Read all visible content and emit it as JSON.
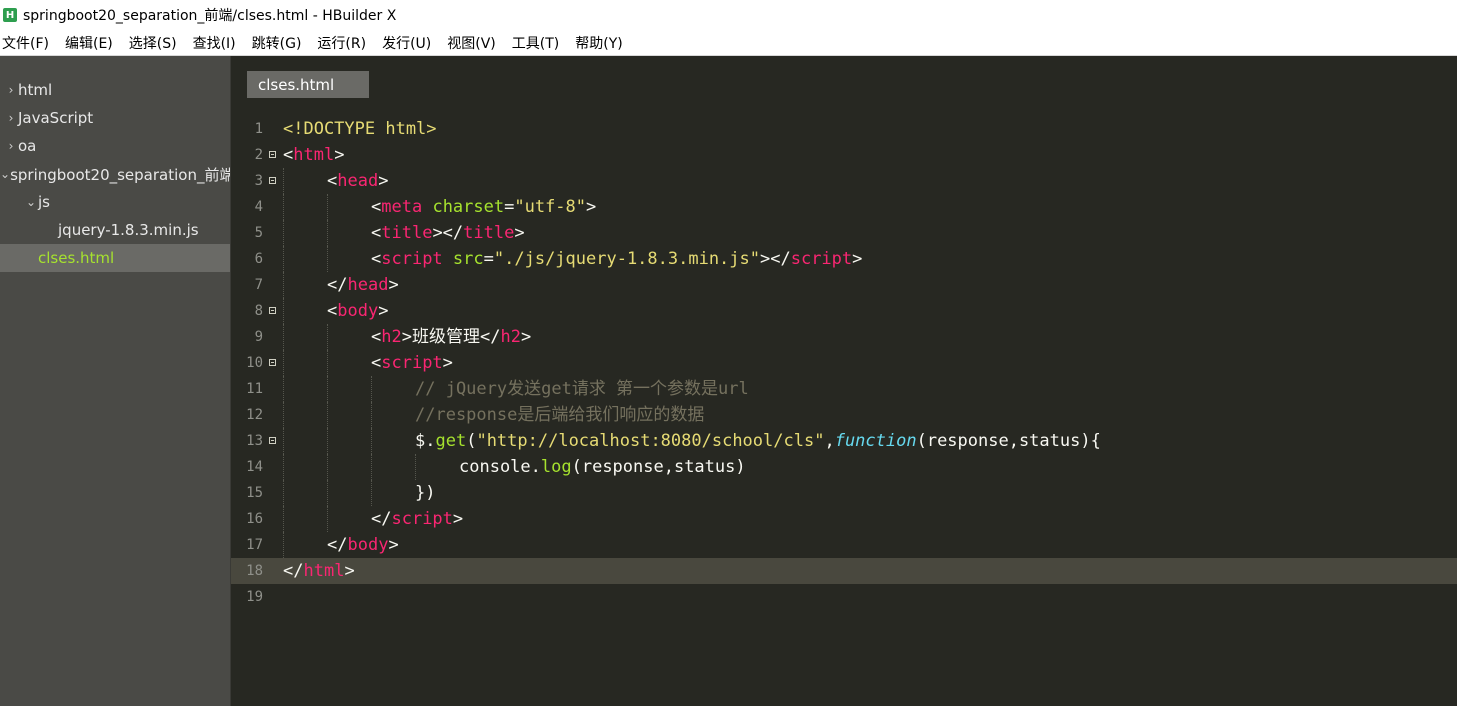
{
  "window": {
    "title": "springboot20_separation_前端/clses.html - HBuilder X",
    "icon_text": "H"
  },
  "menu": [
    "文件(F)",
    "编辑(E)",
    "选择(S)",
    "查找(I)",
    "跳转(G)",
    "运行(R)",
    "发行(U)",
    "视图(V)",
    "工具(T)",
    "帮助(Y)"
  ],
  "sidebar": {
    "items": [
      {
        "label": "html",
        "indent": 0,
        "chevron": "›"
      },
      {
        "label": "JavaScript",
        "indent": 0,
        "chevron": "›"
      },
      {
        "label": "oa",
        "indent": 0,
        "chevron": "›"
      },
      {
        "label": "springboot20_separation_前端",
        "indent": 0,
        "chevron": "⌄"
      },
      {
        "label": "js",
        "indent": 1,
        "chevron": "⌄"
      },
      {
        "label": "jquery-1.8.3.min.js",
        "indent": 2,
        "chevron": ""
      },
      {
        "label": "clses.html",
        "indent": 1,
        "chevron": "",
        "selected": true,
        "color": "#a6e22e"
      }
    ]
  },
  "editor": {
    "tab_label": "clses.html",
    "current_line": 18,
    "lines": [
      {
        "n": "1",
        "fold": false,
        "depth": 0,
        "tokens": [
          [
            "t-str",
            "<!DOCTYPE html>"
          ]
        ]
      },
      {
        "n": "2",
        "fold": true,
        "depth": 0,
        "tokens": [
          [
            "t-pl",
            "<"
          ],
          [
            "t-tag",
            "html"
          ],
          [
            "t-pl",
            ">"
          ]
        ]
      },
      {
        "n": "3",
        "fold": true,
        "depth": 1,
        "tokens": [
          [
            "t-pl",
            "<"
          ],
          [
            "t-tag",
            "head"
          ],
          [
            "t-pl",
            ">"
          ]
        ]
      },
      {
        "n": "4",
        "fold": false,
        "depth": 2,
        "tokens": [
          [
            "t-pl",
            "<"
          ],
          [
            "t-tag",
            "meta"
          ],
          [
            "t-pl",
            " "
          ],
          [
            "t-attr",
            "charset"
          ],
          [
            "t-pl",
            "="
          ],
          [
            "t-str",
            "\"utf-8\""
          ],
          [
            "t-pl",
            ">"
          ]
        ]
      },
      {
        "n": "5",
        "fold": false,
        "depth": 2,
        "tokens": [
          [
            "t-pl",
            "<"
          ],
          [
            "t-tag",
            "title"
          ],
          [
            "t-pl",
            "></"
          ],
          [
            "t-tag",
            "title"
          ],
          [
            "t-pl",
            ">"
          ]
        ]
      },
      {
        "n": "6",
        "fold": false,
        "depth": 2,
        "tokens": [
          [
            "t-pl",
            "<"
          ],
          [
            "t-tag",
            "script"
          ],
          [
            "t-pl",
            " "
          ],
          [
            "t-attr",
            "src"
          ],
          [
            "t-pl",
            "="
          ],
          [
            "t-str",
            "\"./js/jquery-1.8.3.min.js\""
          ],
          [
            "t-pl",
            "></"
          ],
          [
            "t-tag",
            "script"
          ],
          [
            "t-pl",
            ">"
          ]
        ]
      },
      {
        "n": "7",
        "fold": false,
        "depth": 1,
        "tokens": [
          [
            "t-pl",
            "</"
          ],
          [
            "t-tag",
            "head"
          ],
          [
            "t-pl",
            ">"
          ]
        ]
      },
      {
        "n": "8",
        "fold": true,
        "depth": 1,
        "tokens": [
          [
            "t-pl",
            "<"
          ],
          [
            "t-tag",
            "body"
          ],
          [
            "t-pl",
            ">"
          ]
        ]
      },
      {
        "n": "9",
        "fold": false,
        "depth": 2,
        "tokens": [
          [
            "t-pl",
            "<"
          ],
          [
            "t-tag",
            "h2"
          ],
          [
            "t-pl",
            ">班级管理</"
          ],
          [
            "t-tag",
            "h2"
          ],
          [
            "t-pl",
            ">"
          ]
        ]
      },
      {
        "n": "10",
        "fold": true,
        "depth": 2,
        "tokens": [
          [
            "t-pl",
            "<"
          ],
          [
            "t-tag",
            "script"
          ],
          [
            "t-pl",
            ">"
          ]
        ]
      },
      {
        "n": "11",
        "fold": false,
        "depth": 3,
        "tokens": [
          [
            "t-cm",
            "// jQuery发送get请求 第一个参数是url"
          ]
        ]
      },
      {
        "n": "12",
        "fold": false,
        "depth": 3,
        "tokens": [
          [
            "t-cm",
            "//response是后端给我们响应的数据"
          ]
        ]
      },
      {
        "n": "13",
        "fold": true,
        "depth": 3,
        "tokens": [
          [
            "t-pl",
            "$."
          ],
          [
            "t-fn",
            "get"
          ],
          [
            "t-pl",
            "("
          ],
          [
            "t-str",
            "\"http://localhost:8080/school/cls\""
          ],
          [
            "t-pl",
            ","
          ],
          [
            "t-kw",
            "function"
          ],
          [
            "t-pl",
            "(response,status){"
          ]
        ]
      },
      {
        "n": "14",
        "fold": false,
        "depth": 4,
        "tokens": [
          [
            "t-pl",
            "console."
          ],
          [
            "t-fn",
            "log"
          ],
          [
            "t-pl",
            "(response,status)"
          ]
        ]
      },
      {
        "n": "15",
        "fold": false,
        "depth": 3,
        "tokens": [
          [
            "t-pl",
            "})"
          ]
        ]
      },
      {
        "n": "16",
        "fold": false,
        "depth": 2,
        "tokens": [
          [
            "t-pl",
            "</"
          ],
          [
            "t-tag",
            "script"
          ],
          [
            "t-pl",
            ">"
          ]
        ]
      },
      {
        "n": "17",
        "fold": false,
        "depth": 1,
        "tokens": [
          [
            "t-pl",
            "</"
          ],
          [
            "t-tag",
            "body"
          ],
          [
            "t-pl",
            ">"
          ]
        ]
      },
      {
        "n": "18",
        "fold": false,
        "depth": 0,
        "tokens": [
          [
            "t-pl",
            "</"
          ],
          [
            "t-tag",
            "html"
          ],
          [
            "t-pl",
            ">"
          ]
        ]
      },
      {
        "n": "19",
        "fold": false,
        "depth": 0,
        "tokens": []
      }
    ]
  }
}
